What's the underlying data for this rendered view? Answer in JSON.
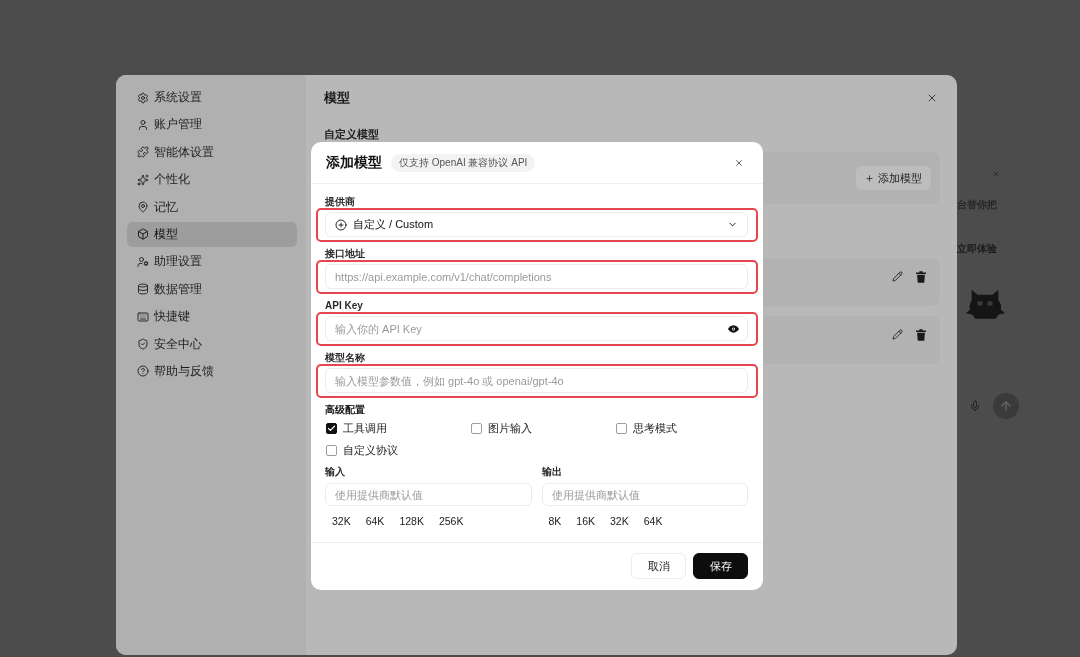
{
  "sidebar": {
    "items": [
      {
        "label": "系统设置",
        "selected": false
      },
      {
        "label": "账户管理",
        "selected": false
      },
      {
        "label": "智能体设置",
        "selected": false
      },
      {
        "label": "个性化",
        "selected": false
      },
      {
        "label": "记忆",
        "selected": false
      },
      {
        "label": "模型",
        "selected": true
      },
      {
        "label": "助理设置",
        "selected": false
      },
      {
        "label": "数据管理",
        "selected": false
      },
      {
        "label": "快捷键",
        "selected": false
      },
      {
        "label": "安全中心",
        "selected": false
      },
      {
        "label": "帮助与反馈",
        "selected": false
      }
    ]
  },
  "panel": {
    "title": "模型",
    "section_title": "自定义模型",
    "add_button": "添加模型"
  },
  "dialog": {
    "title": "添加模型",
    "badge": "仅支持 OpenAI 兼容协议 API",
    "fields": [
      {
        "kind": "select",
        "label": "提供商",
        "value": "自定义 / Custom",
        "highlighted": true
      },
      {
        "kind": "text",
        "label": "接口地址",
        "placeholder": "https://api.example.com/v1/chat/completions",
        "highlighted": true
      },
      {
        "kind": "password",
        "label": "API Key",
        "placeholder": "输入你的 API Key",
        "highlighted": true
      },
      {
        "kind": "text",
        "label": "模型名称",
        "placeholder": "输入模型参数值，例如 gpt-4o 或 openai/gpt-4o",
        "highlighted": true
      }
    ],
    "advanced": {
      "title": "高级配置",
      "options": [
        {
          "label": "工具调用",
          "checked": true
        },
        {
          "label": "图片输入",
          "checked": false
        },
        {
          "label": "思考模式",
          "checked": false
        },
        {
          "label": "自定义协议",
          "checked": false
        }
      ],
      "limits": [
        {
          "label": "输入",
          "placeholder": "使用提供商默认值",
          "presets": [
            "32K",
            "64K",
            "128K",
            "256K"
          ]
        },
        {
          "label": "输出",
          "placeholder": "使用提供商默认值",
          "presets": [
            "8K",
            "16K",
            "32K",
            "64K"
          ]
        }
      ]
    },
    "buttons": [
      {
        "kind": "secondary",
        "label": "取消"
      },
      {
        "kind": "primary",
        "label": "保存"
      }
    ]
  },
  "background_app": {
    "notice": "台替你把",
    "action": "立即体验"
  }
}
